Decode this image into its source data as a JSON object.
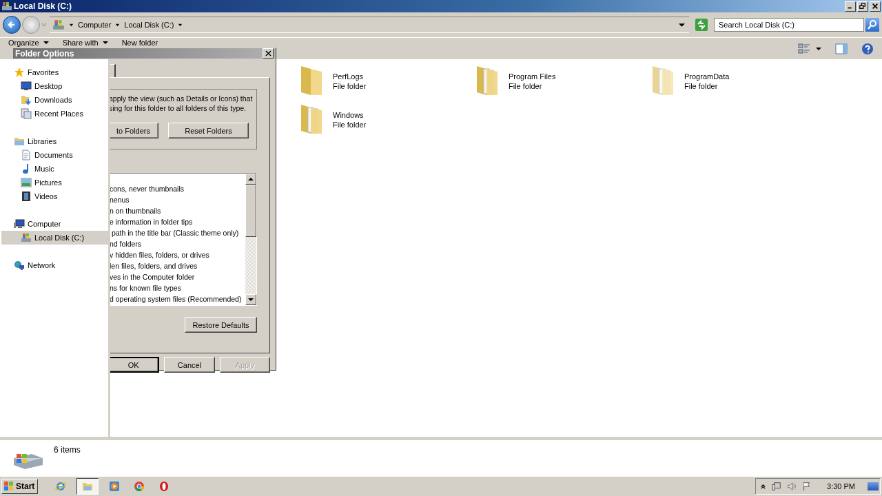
{
  "window": {
    "title": "Local Disk (C:)"
  },
  "address": {
    "breadcrumb": [
      "Computer",
      "Local Disk (C:)"
    ]
  },
  "search": {
    "placeholder": "Search Local Disk (C:)"
  },
  "toolbar": [
    {
      "label": "Organize",
      "dropdown": true
    },
    {
      "label": "Share with",
      "dropdown": true
    },
    {
      "label": "New folder",
      "dropdown": false
    }
  ],
  "navigation": [
    {
      "label": "Favorites",
      "kind": "star",
      "selected": false,
      "children": [
        {
          "label": "Desktop",
          "kind": "desktop",
          "selected": false
        },
        {
          "label": "Downloads",
          "kind": "downloads",
          "selected": false
        },
        {
          "label": "Recent Places",
          "kind": "recent",
          "selected": false
        }
      ]
    },
    {
      "label": "Libraries",
      "kind": "library",
      "selected": false,
      "children": [
        {
          "label": "Documents",
          "kind": "document",
          "selected": false
        },
        {
          "label": "Music",
          "kind": "music",
          "selected": false
        },
        {
          "label": "Pictures",
          "kind": "pictures",
          "selected": false
        },
        {
          "label": "Videos",
          "kind": "videos",
          "selected": false
        }
      ]
    },
    {
      "label": "Computer",
      "kind": "computer",
      "selected": false,
      "children": [
        {
          "label": "Local Disk (C:)",
          "kind": "drive",
          "selected": true
        }
      ]
    },
    {
      "label": "Network",
      "kind": "network",
      "selected": false
    }
  ],
  "items": [
    {
      "name": "PerfLogs",
      "type": "File folder",
      "kind": "empty"
    },
    {
      "name": "Program Files",
      "type": "File folder",
      "kind": "filled"
    },
    {
      "name": "ProgramData",
      "type": "File folder",
      "kind": "faded"
    },
    {
      "name": "Windows",
      "type": "File folder",
      "kind": "filled"
    }
  ],
  "dialog": {
    "title": "Folder Options",
    "folder_views_text": [
      "apply the view (such as Details or Icons) that",
      "sing for this folder to all folders of this type."
    ],
    "folder_buttons": [
      "to Folders",
      "Reset Folders"
    ],
    "settings": [
      "cons, never thumbnails",
      "nenus",
      "n on thumbnails",
      "e information in folder tips",
      " path in the title bar (Classic theme only)",
      "nd folders",
      "v hidden files, folders, or drives",
      "len files, folders, and drives",
      "ves in the Computer folder",
      "ns for known file types",
      "d operating system files (Recommended)"
    ],
    "restore_button": "Restore Defaults",
    "buttons": [
      {
        "label": "OK",
        "disabled": false,
        "default": true
      },
      {
        "label": "Cancel",
        "disabled": false,
        "default": false
      },
      {
        "label": "Apply",
        "disabled": true,
        "default": false
      }
    ]
  },
  "details": {
    "count": "6 items"
  },
  "taskbar": {
    "start": "Start",
    "apps": [
      {
        "kind": "ie",
        "selected": false
      },
      {
        "kind": "explorer",
        "selected": true
      },
      {
        "kind": "media",
        "selected": false
      },
      {
        "kind": "chrome",
        "selected": false
      },
      {
        "kind": "opera",
        "selected": false
      }
    ],
    "clock": "3:30 PM"
  }
}
